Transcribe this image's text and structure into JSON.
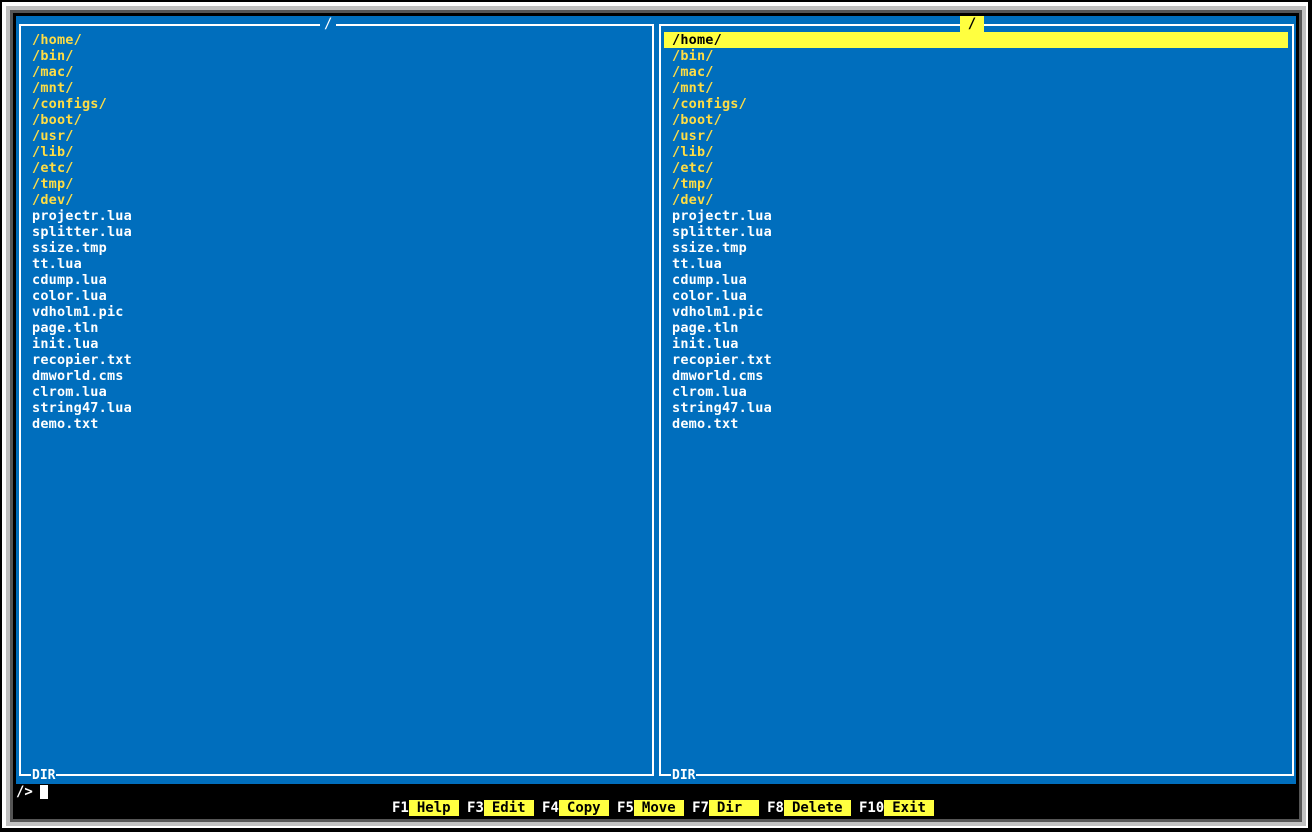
{
  "colors": {
    "background": "#006ebd",
    "directory": "#ffdd44",
    "file": "#ffffff",
    "highlight": "#ffff40",
    "footer_bg": "#000000"
  },
  "left_panel": {
    "title": "/",
    "footer_label": "DIR",
    "entries": [
      {
        "name": "/home/",
        "type": "dir"
      },
      {
        "name": "/bin/",
        "type": "dir"
      },
      {
        "name": "/mac/",
        "type": "dir"
      },
      {
        "name": "/mnt/",
        "type": "dir"
      },
      {
        "name": "/configs/",
        "type": "dir"
      },
      {
        "name": "/boot/",
        "type": "dir"
      },
      {
        "name": "/usr/",
        "type": "dir"
      },
      {
        "name": "/lib/",
        "type": "dir"
      },
      {
        "name": "/etc/",
        "type": "dir"
      },
      {
        "name": "/tmp/",
        "type": "dir"
      },
      {
        "name": "/dev/",
        "type": "dir"
      },
      {
        "name": "projectr.lua",
        "type": "file"
      },
      {
        "name": "splitter.lua",
        "type": "file"
      },
      {
        "name": "ssize.tmp",
        "type": "file"
      },
      {
        "name": "tt.lua",
        "type": "file"
      },
      {
        "name": "cdump.lua",
        "type": "file"
      },
      {
        "name": "color.lua",
        "type": "file"
      },
      {
        "name": "vdholm1.pic",
        "type": "file"
      },
      {
        "name": "page.tln",
        "type": "file"
      },
      {
        "name": "init.lua",
        "type": "file"
      },
      {
        "name": "recopier.txt",
        "type": "file"
      },
      {
        "name": "dmworld.cms",
        "type": "file"
      },
      {
        "name": "clrom.lua",
        "type": "file"
      },
      {
        "name": "string47.lua",
        "type": "file"
      },
      {
        "name": "demo.txt",
        "type": "file"
      }
    ]
  },
  "right_panel": {
    "title": "/",
    "active": true,
    "footer_label": "DIR",
    "selected_index": 0,
    "entries": [
      {
        "name": "/home/",
        "type": "dir"
      },
      {
        "name": "/bin/",
        "type": "dir"
      },
      {
        "name": "/mac/",
        "type": "dir"
      },
      {
        "name": "/mnt/",
        "type": "dir"
      },
      {
        "name": "/configs/",
        "type": "dir"
      },
      {
        "name": "/boot/",
        "type": "dir"
      },
      {
        "name": "/usr/",
        "type": "dir"
      },
      {
        "name": "/lib/",
        "type": "dir"
      },
      {
        "name": "/etc/",
        "type": "dir"
      },
      {
        "name": "/tmp/",
        "type": "dir"
      },
      {
        "name": "/dev/",
        "type": "dir"
      },
      {
        "name": "projectr.lua",
        "type": "file"
      },
      {
        "name": "splitter.lua",
        "type": "file"
      },
      {
        "name": "ssize.tmp",
        "type": "file"
      },
      {
        "name": "tt.lua",
        "type": "file"
      },
      {
        "name": "cdump.lua",
        "type": "file"
      },
      {
        "name": "color.lua",
        "type": "file"
      },
      {
        "name": "vdholm1.pic",
        "type": "file"
      },
      {
        "name": "page.tln",
        "type": "file"
      },
      {
        "name": "init.lua",
        "type": "file"
      },
      {
        "name": "recopier.txt",
        "type": "file"
      },
      {
        "name": "dmworld.cms",
        "type": "file"
      },
      {
        "name": "clrom.lua",
        "type": "file"
      },
      {
        "name": "string47.lua",
        "type": "file"
      },
      {
        "name": "demo.txt",
        "type": "file"
      }
    ]
  },
  "command_line": {
    "prompt": "/>",
    "value": ""
  },
  "function_keys": [
    {
      "key": "F1",
      "label": "Help "
    },
    {
      "key": "F3",
      "label": "Edit "
    },
    {
      "key": "F4",
      "label": "Copy "
    },
    {
      "key": "F5",
      "label": "Move "
    },
    {
      "key": "F7",
      "label": "Dir  "
    },
    {
      "key": "F8",
      "label": "Delete "
    },
    {
      "key": "F10",
      "label": "Exit "
    }
  ]
}
